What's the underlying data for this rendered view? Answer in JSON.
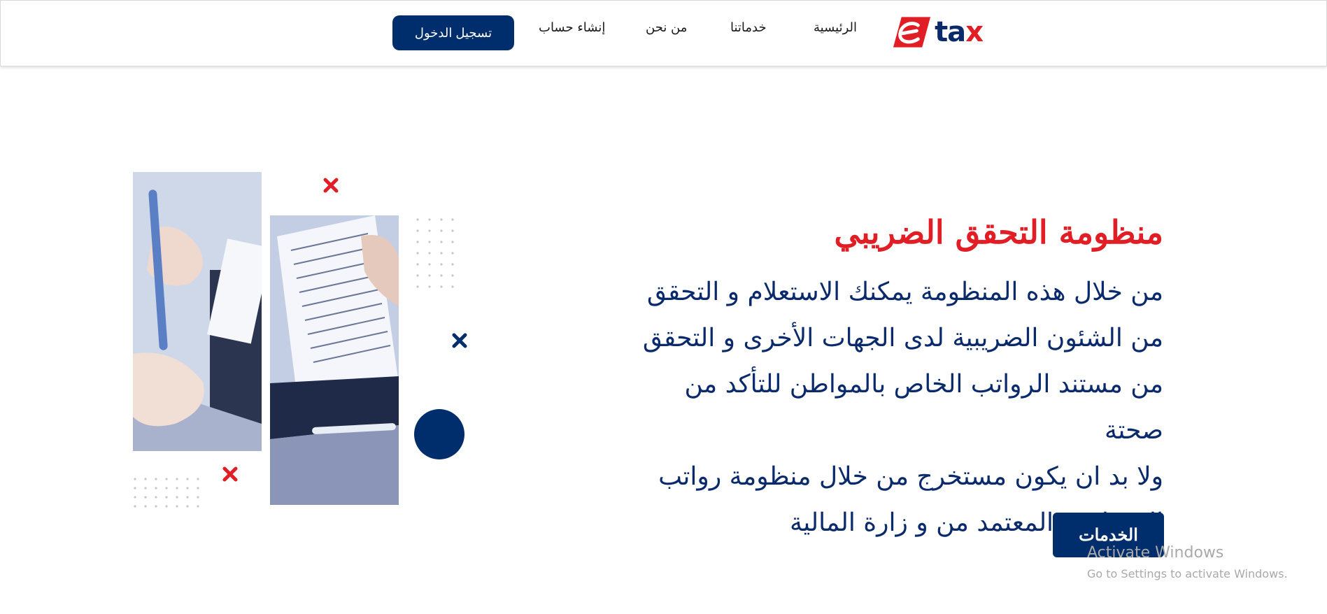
{
  "header": {
    "logo": {
      "text_main": "ta",
      "text_accent": "x",
      "icon": "e-logo-icon"
    },
    "nav": [
      {
        "label": "الرئيسية"
      },
      {
        "label": "خدماتنا"
      },
      {
        "label": "من نحن"
      },
      {
        "label": "إنشاء حساب"
      }
    ],
    "login_label": "تسجيل الدخول"
  },
  "hero": {
    "title": "منظومة التحقق الضريبي",
    "body_lines": [
      "من خلال هذه المنظومة يمكنك الاستعلام و التحقق",
      "من الشئون الضريبية لدى الجهات الأخرى و التحقق",
      "من مستند الرواتب الخاص بالمواطن للتأكد من صحتة",
      "ولا بد ان يكون مستخرج من خلال منظومة رواتب",
      "الموظفين المعتمد من و زارة المالية"
    ],
    "services_label": "الخدمات"
  },
  "watermark": {
    "title": "Activate Windows",
    "subtitle": "Go to Settings to activate Windows."
  },
  "colors": {
    "brand_navy": "#002d6b",
    "text_navy": "#0a2a6b",
    "accent_red": "#e11d25"
  },
  "icons": {
    "cross": "close-icon",
    "circle": "circle-decoration"
  }
}
